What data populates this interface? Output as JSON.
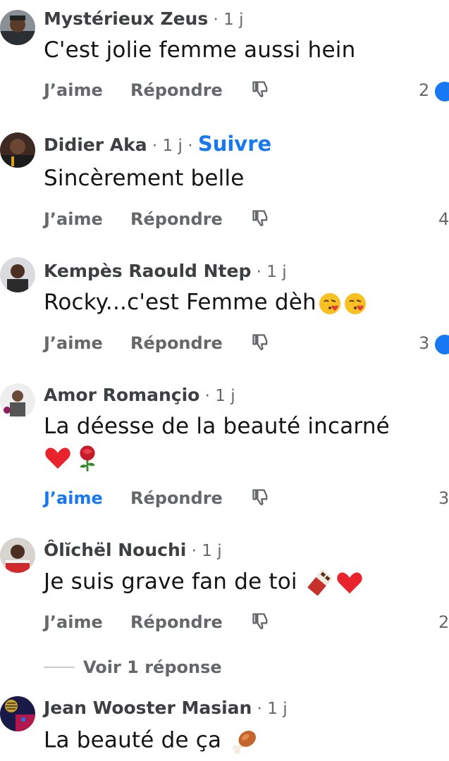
{
  "actions": {
    "like_label": "J’aime",
    "reply_label": "Répondre",
    "view_replies": "Voir 1 réponse"
  },
  "comments": [
    {
      "author": "Mystérieux Zeus",
      "meta": " · 1 j",
      "text": "C'est jolie femme aussi hein",
      "reaction_count": "2",
      "liked": false
    },
    {
      "author": "Didier Aka",
      "meta": " · 1 j · ",
      "follow": "Suivre",
      "text": "Sincèrement belle",
      "reaction_count": "4",
      "liked": false
    },
    {
      "author": "Kempès Raould Ntep",
      "meta": " · 1 j",
      "text": "Rocky...c'est Femme dèh",
      "text_emojis": [
        "kissing-heart-emoji",
        "kissing-heart-emoji"
      ],
      "reaction_count": "3",
      "liked": false
    },
    {
      "author": "Amor Romançio",
      "meta": " · 1 j",
      "text": "La déesse de la beauté incarné",
      "line2_emojis": [
        "red-heart-emoji",
        "rose-emoji"
      ],
      "reaction_count": "3",
      "liked": true
    },
    {
      "author": "Ôlĭchël Nouchi",
      "meta": " · 1 j",
      "text": "Je suis grave fan de toi",
      "text_emojis": [
        "chocolate-bar-emoji",
        "red-heart-emoji"
      ],
      "reaction_count": "2",
      "liked": false
    },
    {
      "author": "Jean Wooster Masian",
      "meta": " · 1 j",
      "text": "La beauté de ça",
      "text_emojis": [
        "meat-on-bone-emoji"
      ]
    }
  ],
  "colors": {
    "accent": "#1877f2",
    "secondary_text": "#65676b",
    "primary_text": "#141414"
  }
}
